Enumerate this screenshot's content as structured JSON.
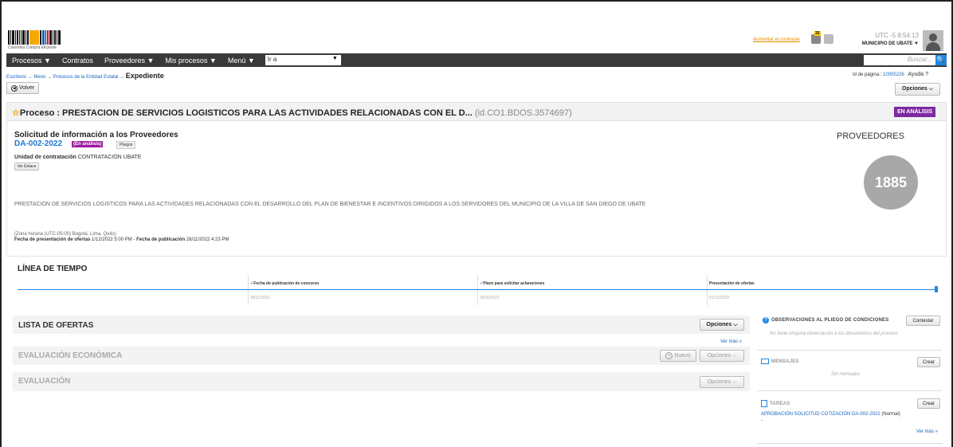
{
  "header": {
    "brand_caption": "Colombia Compra Eficiente",
    "contrast_link": "Aumentar el contraste",
    "mail_count": "33",
    "time": "UTC -5 8:54:13",
    "entity": "MUNICIPIO DE UBATE ▼"
  },
  "nav": {
    "items": [
      {
        "label": "Procesos ▼"
      },
      {
        "label": "Contratos"
      },
      {
        "label": "Proveedores ▼"
      },
      {
        "label": "Mis procesos ▼"
      },
      {
        "label": "Menú ▼"
      }
    ],
    "goto_label": "Ir a",
    "goto_arrow": "▼",
    "search_placeholder": "Buscar...",
    "search_icon": "🔍"
  },
  "breadcrumb": {
    "items": [
      "Escritorio",
      "Menú",
      "Procesos de la Entidad Estatal"
    ],
    "separator": "→",
    "current": "Expediente"
  },
  "page_id": {
    "label": "Id de página:: ",
    "value": "10005226",
    "help": "Ayuda ?"
  },
  "buttons": {
    "back": "Volver",
    "options": "Opciones ⌵"
  },
  "process": {
    "star": "☆",
    "title": "Proceso : PRESTACION DE SERVICIOS LOGISTICOS PARA LAS ACTIVIDADES RELACIONADAS CON EL D...",
    "id": "(id.CO1.BDOS.3574697)",
    "status": "EN ANÁLISIS",
    "request_title": "Solicitud de información a los Proveedores",
    "code": "DA-002-2022",
    "code_status": "(En análisis)",
    "pliegos": "Pliegos",
    "unit_label": "Unidad de contratación",
    "unit_value": "CONTRATACIÓN UBATE",
    "link_button": "Ver Enlace",
    "description": "PRESTACION DE SERVICIOS LOGISTICOS PARA LAS ACTIVIDADES RELACIONADAS CON EL DESARROLLO DEL PLAN DE BIENESTAR E INCENTIVOS DIRIGIDOS A LOS SERVIDORES DEL MUNICIPIO DE LA VILLA DE SAN DIEGO DE UBATE",
    "timezone": "(Zona horaria (UTC-05:00) Bogotá, Lima, Quito)",
    "offers_date_label": "Fecha de presentación de ofertas",
    "offers_date": "1/12/2022 5:00 PM",
    "pub_date_label": "Fecha de publicación",
    "pub_date": "28/11/2022 4:23 PM",
    "providers_label": "PROVEEDORES",
    "providers_count": "1885"
  },
  "timeline": {
    "title": "LÍNEA DE TIEMPO",
    "events": [
      {
        "check": "✓",
        "label": "Fecha de publicación de concurso",
        "date": "28/11/2022"
      },
      {
        "check": "✓",
        "label": "Plazo para solicitar aclaraciones",
        "date": "29/11/2022"
      },
      {
        "check": "",
        "label": "Presentación de ofertas",
        "date": "01/12/2022"
      }
    ]
  },
  "sections": {
    "offers": "LISTA DE OFERTAS",
    "economic": "EVALUACIÓN ECONÓMICA",
    "evaluation": "EVALUACIÓN",
    "options": "Opciones ⌵",
    "new": "Nuevo",
    "new_icon": "+",
    "see_more": "Ver más »"
  },
  "side": {
    "observations_title": "OBSERVACIONES AL PLIEGO DE CONDICIONES",
    "observations_icon": "?",
    "answer": "Contestar",
    "observations_empty": "No tiene ninguna observación a los documentos del proceso",
    "messages_title": "MENSAJES",
    "messages_empty": "Sin mensajes",
    "create": "Crear",
    "tasks_title": "TAREAS",
    "task_link": "APROBACIÓN SOLICITUD COTIZACIÓN DA-002-2022",
    "task_priority": "(Normal)",
    "task_dash": "-",
    "see_more": "Ver más »"
  }
}
